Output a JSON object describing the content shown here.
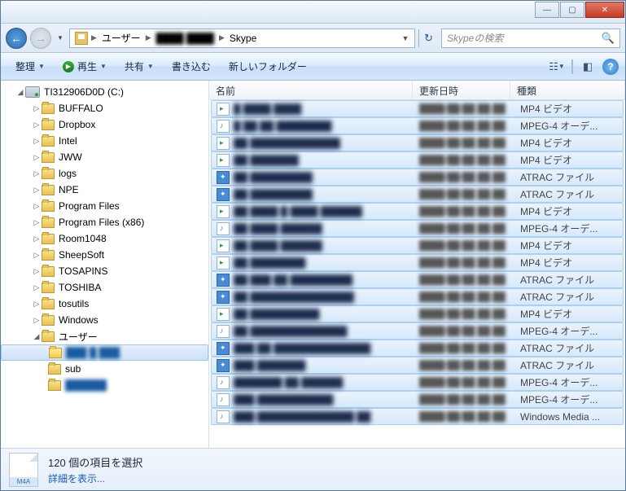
{
  "titlebar": {
    "min": "—",
    "max": "▢",
    "close": "✕"
  },
  "nav": {
    "crumbs": [
      "ユーザー",
      "████ ████",
      "Skype"
    ],
    "search_placeholder": "Skypeの検索"
  },
  "toolbar": {
    "organize": "整理",
    "play": "再生",
    "share": "共有",
    "burn": "書き込む",
    "newfolder": "新しいフォルダー"
  },
  "tree": {
    "drive": "TI312906D0D (C:)",
    "items": [
      "BUFFALO",
      "Dropbox",
      "Intel",
      "JWW",
      "logs",
      "NPE",
      "Program Files",
      "Program Files (x86)",
      "Room1048",
      "SheepSoft",
      "TOSAPINS",
      "TOSHIBA",
      "tosutils",
      "Windows",
      "ユーザー"
    ],
    "sel": "███ █ ███",
    "sub": "sub",
    "last": "██████"
  },
  "list": {
    "headers": {
      "name": "名前",
      "date": "更新日時",
      "type": "種類"
    },
    "rows": [
      {
        "icon": "vid",
        "name": "█ ████ ████",
        "date": "████/██/██ ██:██",
        "type": "MP4 ビデオ"
      },
      {
        "icon": "aud",
        "name": "█ ██ ██ ████████",
        "date": "████/██/██ ██:██",
        "type": "MPEG-4 オーデ..."
      },
      {
        "icon": "vid",
        "name": "██ █████████████",
        "date": "████/██/██ ██:██",
        "type": "MP4 ビデオ"
      },
      {
        "icon": "vid",
        "name": "██ ███████",
        "date": "████/██/██ ██:██",
        "type": "MP4 ビデオ"
      },
      {
        "icon": "atr",
        "name": "██ █████████",
        "date": "████/██/██ ██:██",
        "type": "ATRAC ファイル"
      },
      {
        "icon": "atr",
        "name": "██ █████████",
        "date": "████/██/██ ██:██",
        "type": "ATRAC ファイル"
      },
      {
        "icon": "vid",
        "name": "██ ████ █ ████ ██████",
        "date": "████/██/██ ██:██",
        "type": "MP4 ビデオ"
      },
      {
        "icon": "aud",
        "name": "██ ████ ██████",
        "date": "████/██/██ ██:██",
        "type": "MPEG-4 オーデ..."
      },
      {
        "icon": "vid",
        "name": "██ ████ ██████",
        "date": "████/██/██ ██:██",
        "type": "MP4 ビデオ"
      },
      {
        "icon": "vid",
        "name": "██ ████████",
        "date": "████/██/██ ██:██",
        "type": "MP4 ビデオ"
      },
      {
        "icon": "atr",
        "name": "██ ███ ██ █████████",
        "date": "████/██/██ ██:██",
        "type": "ATRAC ファイル"
      },
      {
        "icon": "atr",
        "name": "██ ███████████████",
        "date": "████/██/██ ██:██",
        "type": "ATRAC ファイル"
      },
      {
        "icon": "vid",
        "name": "██ ██████████",
        "date": "████/██/██ ██:██",
        "type": "MP4 ビデオ"
      },
      {
        "icon": "aud",
        "name": "██ ██████████████",
        "date": "████/██/██ ██:██",
        "type": "MPEG-4 オーデ..."
      },
      {
        "icon": "atr",
        "name": "███ ██ ██████████████",
        "date": "████/██/██ ██:██",
        "type": "ATRAC ファイル"
      },
      {
        "icon": "atr",
        "name": "███ ███████",
        "date": "████/██/██ ██:██",
        "type": "ATRAC ファイル"
      },
      {
        "icon": "aud",
        "name": "███████ ██ ██████",
        "date": "████/██/██ ██:██",
        "type": "MPEG-4 オーデ..."
      },
      {
        "icon": "aud",
        "name": "███ ███████████",
        "date": "████/██/██ ██:██",
        "type": "MPEG-4 オーデ..."
      },
      {
        "icon": "aud",
        "name": "███ ██████████████ ██",
        "date": "████/██/██ ██:██",
        "type": "Windows Media ..."
      }
    ]
  },
  "details": {
    "thumb_label": "M4A",
    "title": "120 個の項目を選択",
    "link": "詳細を表示..."
  }
}
